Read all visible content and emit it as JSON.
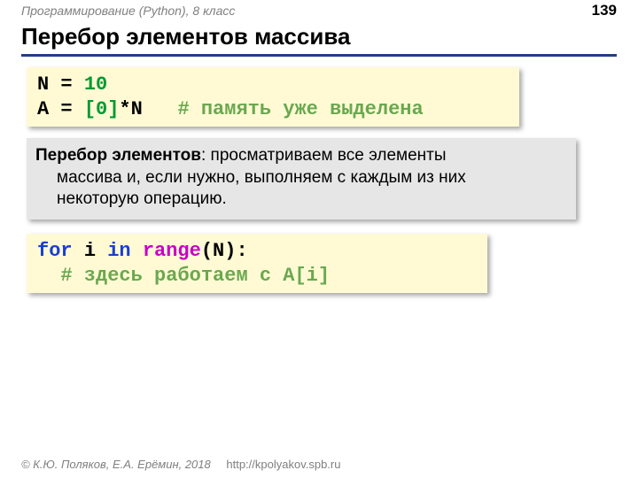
{
  "header": {
    "left": "Программирование (Python), 8 класс",
    "pageNumber": "139"
  },
  "title": "Перебор элементов массива",
  "code1": {
    "l1_varN": "N",
    "l1_eq": " = ",
    "l1_val": "10",
    "l2_varA": "A",
    "l2_eq": " = ",
    "l2_list": "[0]",
    "l2_mulN": "*N",
    "l2_sp": "   ",
    "l2_cmt": "# память уже выделена"
  },
  "explain": {
    "boldLead": "Перебор элементов",
    "rest1": ": просматриваем все элементы",
    "line2": "массива и, если нужно, выполняем с каждым из них",
    "line3": "некоторую операцию."
  },
  "code2": {
    "for": "for",
    "sp1": " ",
    "i": "i",
    "sp2": " ",
    "in": "in",
    "sp3": " ",
    "range": "range",
    "tail": "(N):",
    "l2_indent": "  ",
    "l2_cmt": "# здесь работаем с A[i]"
  },
  "footer": {
    "copy": "© К.Ю. Поляков, Е.А. Ерёмин, 2018",
    "link": "http://kpolyakov.spb.ru"
  }
}
